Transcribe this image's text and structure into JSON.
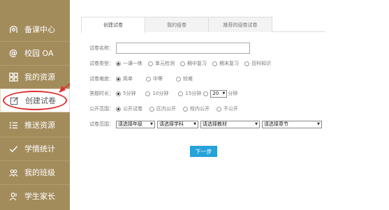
{
  "sidebar": {
    "items": [
      {
        "label": "备课中心",
        "icon": "lesson-prep-icon"
      },
      {
        "label": "校园 OA",
        "icon": "at-sign-icon"
      },
      {
        "label": "我的资源",
        "icon": "grid-icon"
      },
      {
        "label": "创建试卷",
        "icon": "edit-icon"
      },
      {
        "label": "推送资源",
        "icon": "list-icon"
      },
      {
        "label": "学情统计",
        "icon": "checkmark-icon"
      },
      {
        "label": "我的班级",
        "icon": "group-icon"
      },
      {
        "label": "学生家长",
        "icon": "parent-icon"
      }
    ],
    "active_index": 3
  },
  "tabs": [
    {
      "label": "创建试卷"
    },
    {
      "label": "我的组卷"
    },
    {
      "label": "推荐的组卷试卷"
    }
  ],
  "form": {
    "name_label": "试卷名称：",
    "type_label": "试卷类型：",
    "type_options": [
      "一课一练",
      "单元检测",
      "期中复习",
      "期末复习",
      "百科知识"
    ],
    "difficulty_label": "试卷难度：",
    "difficulty_options": [
      "简单",
      "中等",
      "较难"
    ],
    "time_label": "答题时长：",
    "time_options": [
      "5分钟",
      "10分钟",
      "15分钟"
    ],
    "time_custom_value": "20",
    "time_custom_unit": "分钟",
    "scope_label": "公开范围：",
    "scope_options": [
      "公开试卷",
      "区内公开",
      "校内公开",
      "不公开"
    ],
    "range_label": "试卷范围：",
    "range_selects": [
      "请选择年级",
      "请选择学科",
      "请选择教材",
      "请选择章节"
    ],
    "next_button": "下一步"
  },
  "colors": {
    "sidebar": "#a38c5c",
    "accent": "#26a3d8",
    "annotation": "#e03030"
  }
}
